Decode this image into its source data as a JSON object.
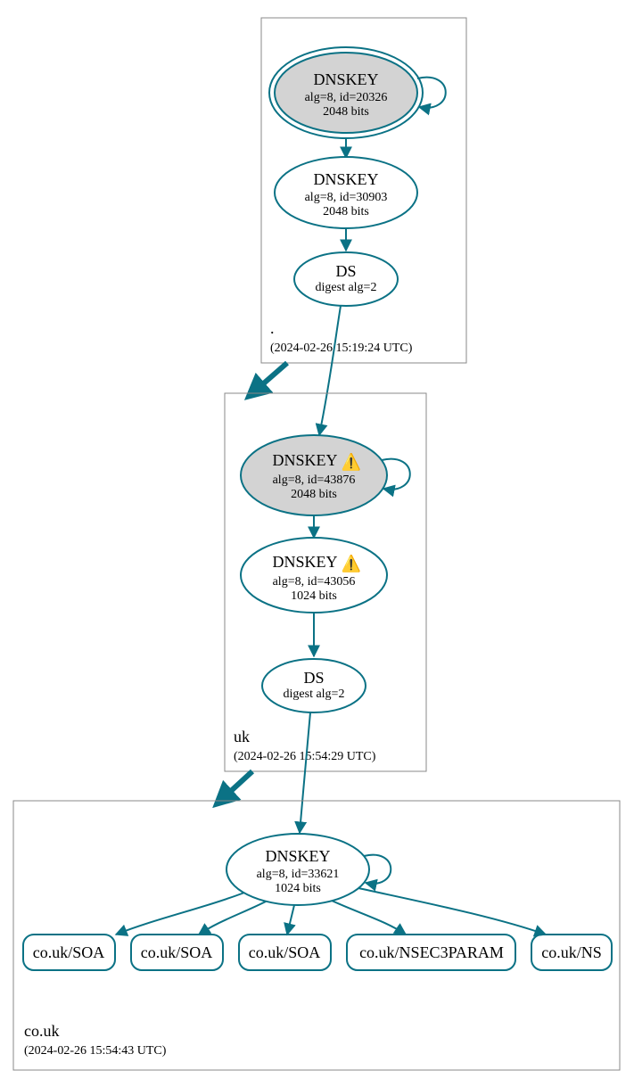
{
  "zones": {
    "root": {
      "label": ".",
      "timestamp": "(2024-02-26 15:19:24 UTC)"
    },
    "uk": {
      "label": "uk",
      "timestamp": "(2024-02-26 15:54:29 UTC)"
    },
    "co_uk": {
      "label": "co.uk",
      "timestamp": "(2024-02-26 15:54:43 UTC)"
    }
  },
  "nodes": {
    "root_ksk": {
      "title": "DNSKEY",
      "line1": "alg=8, id=20326",
      "line2": "2048 bits"
    },
    "root_zsk": {
      "title": "DNSKEY",
      "line1": "alg=8, id=30903",
      "line2": "2048 bits"
    },
    "root_ds": {
      "title": "DS",
      "line1": "digest alg=2"
    },
    "uk_ksk": {
      "title": "DNSKEY",
      "warn": "⚠️",
      "line1": "alg=8, id=43876",
      "line2": "2048 bits"
    },
    "uk_zsk": {
      "title": "DNSKEY",
      "warn": "⚠️",
      "line1": "alg=8, id=43056",
      "line2": "1024 bits"
    },
    "uk_ds": {
      "title": "DS",
      "line1": "digest alg=2"
    },
    "co_uk_dnskey": {
      "title": "DNSKEY",
      "line1": "alg=8, id=33621",
      "line2": "1024 bits"
    }
  },
  "leaves": {
    "soa1": "co.uk/SOA",
    "soa2": "co.uk/SOA",
    "soa3": "co.uk/SOA",
    "nsec3": "co.uk/NSEC3PARAM",
    "ns": "co.uk/NS"
  }
}
